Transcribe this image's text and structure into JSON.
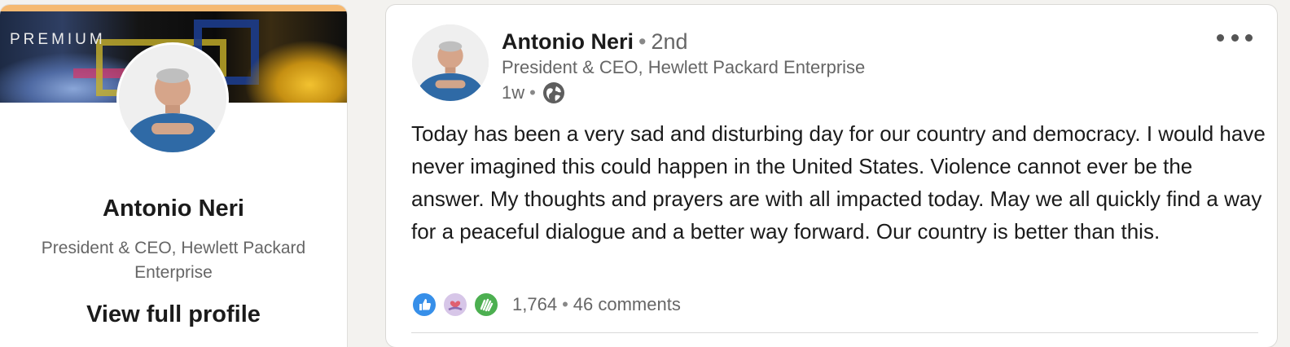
{
  "profile_card": {
    "premium_label": "PREMIUM",
    "name": "Antonio Neri",
    "headline": "President & CEO, Hewlett Packard Enterprise",
    "view_profile_label": "View full profile"
  },
  "post": {
    "author_name": "Antonio Neri",
    "connection_degree": "2nd",
    "author_headline": "President & CEO, Hewlett Packard Enterprise",
    "timestamp": "1w",
    "visibility_icon": "globe-icon",
    "body": "Today has been a very sad and disturbing day for our country and democracy. I would have never imagined this could happen in the United States. Violence cannot ever be the answer. My thoughts and prayers are with all impacted today. May we all quickly find a way for a peaceful dialogue and a better way forward. Our country is better than this.",
    "reactions_icons": [
      "like-icon",
      "support-icon",
      "celebrate-icon"
    ],
    "reactions_count": "1,764",
    "comments_count": "46 comments"
  },
  "colors": {
    "premium_gold": "#f5b971",
    "like_blue": "#378fe9",
    "celebrate_green": "#4caf50",
    "text_primary": "#1b1b1b",
    "text_secondary": "#666666"
  }
}
